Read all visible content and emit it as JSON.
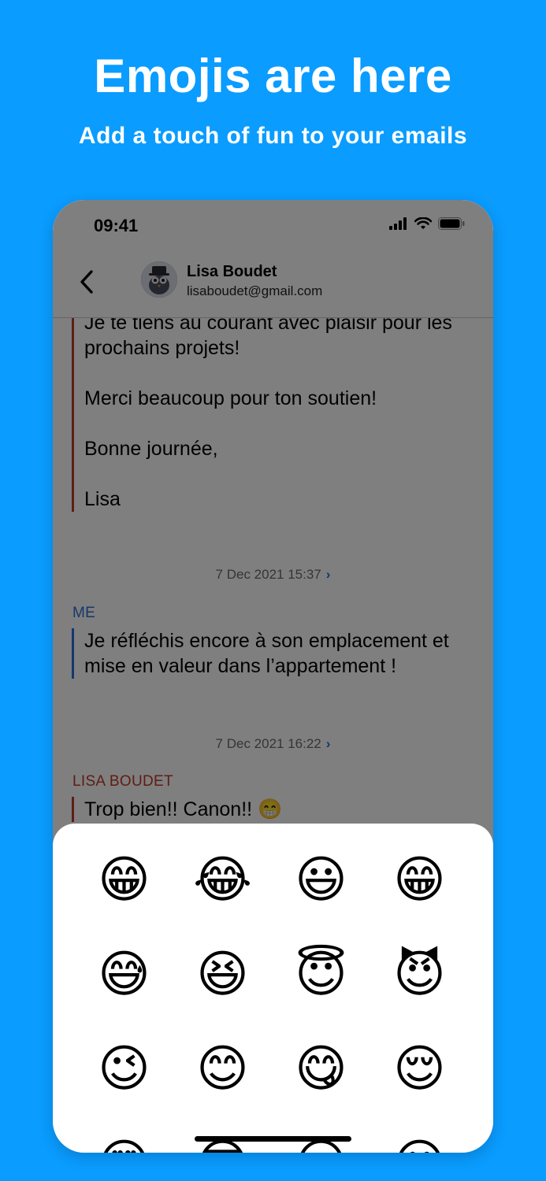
{
  "hero": {
    "title": "Emojis are here",
    "subtitle": "Add a touch of fun to your emails"
  },
  "status_bar": {
    "time": "09:41",
    "icons": [
      "signal-icon",
      "wifi-icon",
      "battery-icon"
    ]
  },
  "nav": {
    "back_icon": "chevron-left-icon",
    "contact_name": "Lisa Boudet",
    "contact_email": "lisaboudet@gmail.com"
  },
  "thread": {
    "first_message": {
      "paragraphs": [
        "Je te tiens au courant avec plaisir pour les prochains projets!",
        "Merci beaucoup pour ton soutien!",
        "Bonne journée,",
        "Lisa"
      ]
    },
    "timestamp_1": "7 Dec 2021 15:37",
    "me_label": "ME",
    "me_message": "Je réfléchis encore à son emplacement et mise en valeur dans l’appartement !",
    "timestamp_2": "7 Dec 2021 16:22",
    "lisa_label": "LISA BOUDET",
    "lisa_message": "Trop bien!! Canon!! 😁"
  },
  "colors": {
    "background": "#0a9cff",
    "lisa_accent": "#c0392b",
    "me_accent": "#2f6fd8",
    "link": "#1a6fe0"
  },
  "emoji_picker": {
    "emojis": [
      "😁",
      "😂",
      "😃",
      "😁",
      "😅",
      "😆",
      "😇",
      "😈",
      "😉",
      "😊",
      "😋",
      "😌",
      "😍",
      "😎",
      "😏",
      "😐"
    ]
  }
}
